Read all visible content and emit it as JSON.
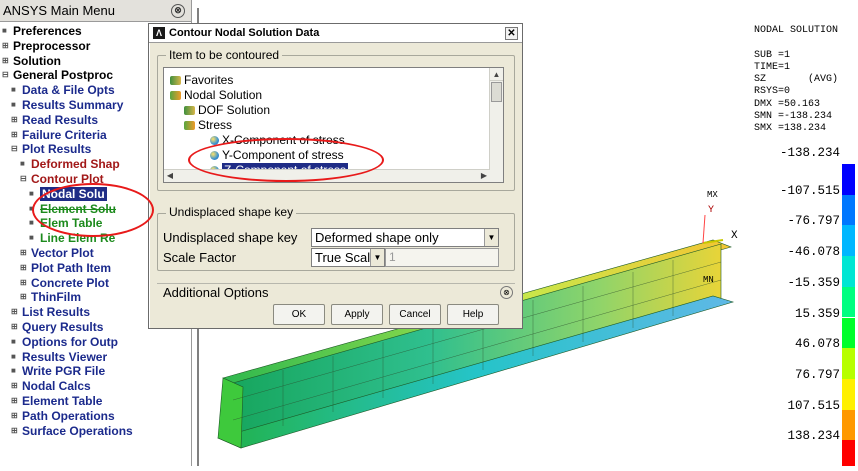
{
  "main_menu": {
    "title": "ANSYS Main Menu",
    "items": [
      {
        "label": "Preferences",
        "marker": "■",
        "color": "black"
      },
      {
        "label": "Preprocessor",
        "marker": "⊞",
        "color": "black"
      },
      {
        "label": "Solution",
        "marker": "⊞",
        "color": "black"
      },
      {
        "label": "General Postproc",
        "marker": "⊟",
        "color": "black"
      },
      {
        "label": "Data & File Opts",
        "marker": "■",
        "color": "blue",
        "indent": 1
      },
      {
        "label": "Results Summary",
        "marker": "■",
        "color": "blue",
        "indent": 1
      },
      {
        "label": "Read Results",
        "marker": "⊞",
        "color": "blue",
        "indent": 1
      },
      {
        "label": "Failure Criteria",
        "marker": "⊞",
        "color": "blue",
        "indent": 1
      },
      {
        "label": "Plot Results",
        "marker": "⊟",
        "color": "blue",
        "indent": 1
      },
      {
        "label": "Deformed Shap",
        "marker": "■",
        "color": "red",
        "indent": 2
      },
      {
        "label": "Contour Plot",
        "marker": "⊟",
        "color": "red",
        "indent": 2
      },
      {
        "label": "Nodal Solu",
        "marker": "■",
        "color": "blue",
        "indent": 3,
        "selected": true
      },
      {
        "label": "Element Solu",
        "marker": "■",
        "color": "green",
        "indent": 3,
        "strike": true
      },
      {
        "label": "Elem Table",
        "marker": "■",
        "color": "green",
        "indent": 3
      },
      {
        "label": "Line Elem Re",
        "marker": "■",
        "color": "green",
        "indent": 3
      },
      {
        "label": "Vector Plot",
        "marker": "⊞",
        "color": "blue",
        "indent": 2
      },
      {
        "label": "Plot Path Item",
        "marker": "⊞",
        "color": "blue",
        "indent": 2
      },
      {
        "label": "Concrete Plot",
        "marker": "⊞",
        "color": "blue",
        "indent": 2
      },
      {
        "label": "ThinFilm",
        "marker": "⊞",
        "color": "blue",
        "indent": 2
      },
      {
        "label": "List Results",
        "marker": "⊞",
        "color": "blue",
        "indent": 1
      },
      {
        "label": "Query Results",
        "marker": "⊞",
        "color": "blue",
        "indent": 1
      },
      {
        "label": "Options for Outp",
        "marker": "■",
        "color": "blue",
        "indent": 1
      },
      {
        "label": "Results Viewer",
        "marker": "■",
        "color": "blue",
        "indent": 1
      },
      {
        "label": "Write PGR File",
        "marker": "■",
        "color": "blue",
        "indent": 1
      },
      {
        "label": "Nodal Calcs",
        "marker": "⊞",
        "color": "blue",
        "indent": 1
      },
      {
        "label": "Element Table",
        "marker": "⊞",
        "color": "blue",
        "indent": 1
      },
      {
        "label": "Path Operations",
        "marker": "⊞",
        "color": "blue",
        "indent": 1
      },
      {
        "label": "Surface Operations",
        "marker": "⊞",
        "color": "blue",
        "indent": 1
      }
    ]
  },
  "dialog": {
    "title": "Contour Nodal Solution Data",
    "item_group_label": "Item to be contoured",
    "tree": [
      {
        "label": "Favorites",
        "icon": "favorites-folder"
      },
      {
        "label": "Nodal Solution",
        "icon": "folder"
      },
      {
        "label": "DOF Solution",
        "icon": "favorites-folder"
      },
      {
        "label": "Stress",
        "icon": "folder"
      },
      {
        "label": "X-Component of stress",
        "icon": "sphere"
      },
      {
        "label": "Y-Component of stress",
        "icon": "sphere"
      },
      {
        "label": "Z-Component of stress",
        "icon": "sphere",
        "selected": true
      }
    ],
    "undisplaced_group_label": "Undisplaced shape key",
    "undisplaced_label": "Undisplaced shape key",
    "undisplaced_value": "Deformed shape only",
    "scale_label": "Scale Factor",
    "scale_value": "True Scale",
    "scale_number": "1",
    "additional_options": "Additional Options",
    "buttons": {
      "ok": "OK",
      "apply": "Apply",
      "cancel": "Cancel",
      "help": "Help"
    }
  },
  "graphics": {
    "header_lines": [
      "NODAL SOLUTION",
      "",
      "SUB =1",
      "TIME=1",
      "SZ       (AVG)",
      "RSYS=0",
      "DMX =50.163",
      "SMN =-138.234",
      "SMX =138.234"
    ],
    "legend_values": [
      "-138.234",
      "-107.515",
      "-76.797",
      "-46.078",
      "-15.359",
      "15.359",
      "46.078",
      "76.797",
      "107.515",
      "138.234"
    ],
    "legend_colors": [
      "#0000ff",
      "#0077ff",
      "#00b7ff",
      "#00e6d3",
      "#00ff80",
      "#00ff2a",
      "#b7ff00",
      "#fff000",
      "#ff9900",
      "#ff0000"
    ],
    "mx_label": "MX",
    "mn_label": "MN",
    "axis_x": "X",
    "axis_y": "Y"
  }
}
